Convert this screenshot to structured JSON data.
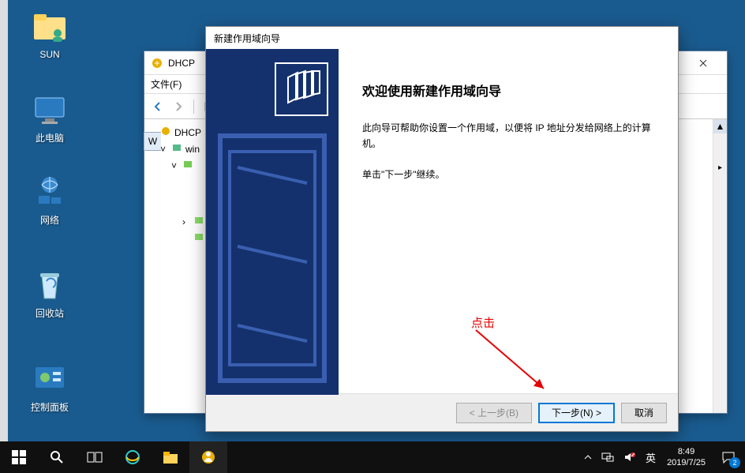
{
  "desktop": {
    "icons": [
      {
        "key": "sun",
        "label": "SUN"
      },
      {
        "key": "this-pc",
        "label": "此电脑"
      },
      {
        "key": "network",
        "label": "网络"
      },
      {
        "key": "recycle",
        "label": "回收站"
      },
      {
        "key": "control-panel",
        "label": "控制面板"
      }
    ]
  },
  "dhcp_window": {
    "title": "DHCP",
    "menu": {
      "file": "文件(F)"
    },
    "tree": {
      "root": "DHCP",
      "server": "win"
    }
  },
  "partial_window": {
    "label": "W"
  },
  "wizard": {
    "title": "新建作用域向导",
    "heading": "欢迎使用新建作用域向导",
    "p1": "此向导可帮助你设置一个作用域，以便将 IP 地址分发给网络上的计算机。",
    "p2": "单击\"下一步\"继续。",
    "annotation": "点击",
    "buttons": {
      "back": "< 上一步(B)",
      "next": "下一步(N) >",
      "cancel": "取消"
    }
  },
  "taskbar": {
    "ime": "英",
    "time": "8:49",
    "date": "2019/7/25",
    "notif_count": "2"
  }
}
